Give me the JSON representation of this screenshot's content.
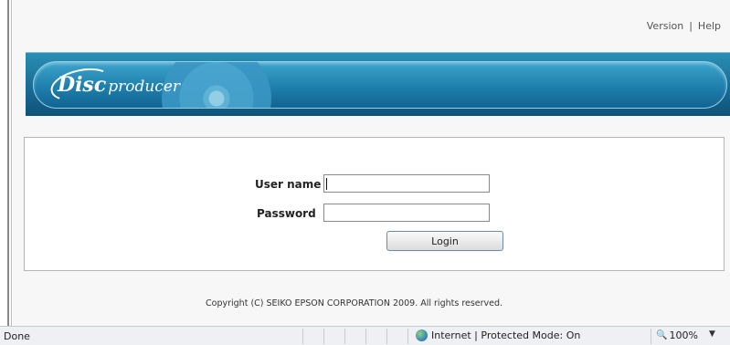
{
  "header": {
    "links": [
      "Version",
      "Help"
    ],
    "separator": "|"
  },
  "banner": {
    "logo_disc": "Disc",
    "logo_producer": "producer",
    "colors": {
      "primary": "#1e7fac",
      "dark": "#0f5279",
      "light": "#8fd0e8"
    }
  },
  "login": {
    "username_label": "User name",
    "username_value": "",
    "password_label": "Password",
    "password_value": "",
    "button_label": "Login"
  },
  "footer": {
    "copyright": "Copyright (C) SEIKO EPSON CORPORATION 2009. All rights reserved."
  },
  "statusbar": {
    "status": "Done",
    "zone": "Internet | Protected Mode: On",
    "zoom": "100%",
    "icons": [
      "globe-icon",
      "zoom-icon",
      "dropdown-arrow-icon"
    ]
  }
}
